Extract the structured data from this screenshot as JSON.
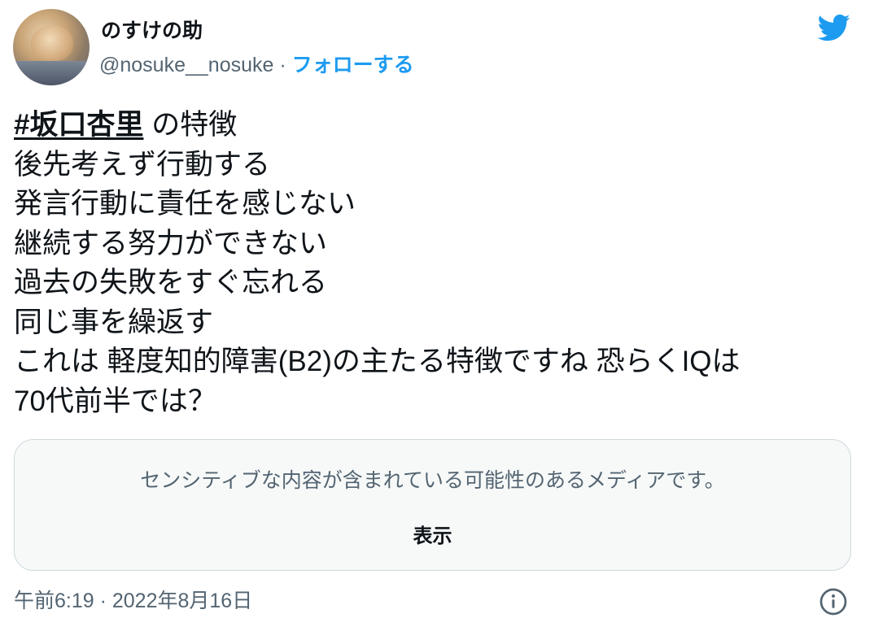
{
  "author": {
    "display_name": "のすけの助",
    "handle": "@nosuke__nosuke",
    "separator": "·",
    "follow_label": "フォローする"
  },
  "tweet": {
    "hashtag": "#坂口杏里",
    "first_line_rest": " の特徴",
    "lines": [
      "後先考えず行動する",
      "発言行動に責任を感じない",
      "継続する努力ができない",
      "過去の失敗をすぐ忘れる",
      "同じ事を繰返す",
      "これは 軽度知的障害(B2)の主たる特徴ですね 恐らくIQは",
      "70代前半では？"
    ]
  },
  "media": {
    "warning": "センシティブな内容が含まれている可能性のあるメディアです。",
    "show_label": "表示"
  },
  "timestamp": "午前6:19 · 2022年8月16日",
  "icons": {
    "brand": "twitter-bird-icon",
    "info": "info-icon"
  },
  "colors": {
    "accent": "#1d9bf0",
    "secondary_text": "#536471",
    "primary_text": "#0f1419",
    "card_background": "#f7f9f9",
    "card_border": "#cfd9de"
  }
}
